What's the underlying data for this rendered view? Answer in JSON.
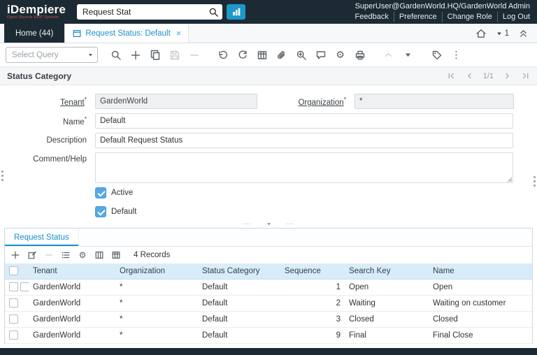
{
  "header": {
    "logo": "iDempiere",
    "tagline": "Open Source ERP System",
    "search": {
      "value": "Request Stat"
    },
    "user": "SuperUser@GardenWorld.HQ/GardenWorld Admin",
    "links": {
      "feedback": "Feedback",
      "preference": "Preference",
      "change_role": "Change Role",
      "logout": "Log Out"
    }
  },
  "tabbar": {
    "home_tab": "Home (44)",
    "active_tab": "Request Status: Default",
    "close": "×",
    "window_count": "1"
  },
  "toolbar": {
    "select_query": "Select Query"
  },
  "titlebar": {
    "title": "Status Category",
    "page_indicator": "1/1"
  },
  "form": {
    "tenant": {
      "label": "Tenant",
      "required": "*",
      "value": "GardenWorld"
    },
    "organization": {
      "label": "Organization",
      "required": "*",
      "value": "*"
    },
    "name": {
      "label": "Name",
      "required": "*",
      "value": "Default"
    },
    "description": {
      "label": "Description",
      "value": "Default Request Status"
    },
    "comment": {
      "label": "Comment/Help",
      "value": ""
    },
    "active": {
      "label": "Active",
      "checked": true
    },
    "default": {
      "label": "Default",
      "checked": true
    }
  },
  "detail": {
    "tab": "Request Status",
    "records": "4 Records",
    "columns": {
      "tenant": "Tenant",
      "organization": "Organization",
      "status_category": "Status Category",
      "sequence": "Sequence",
      "search_key": "Search Key",
      "name": "Name"
    },
    "rows": [
      {
        "tenant": "GardenWorld",
        "organization": "*",
        "status_category": "Default",
        "sequence": "1",
        "search_key": "Open",
        "name": "Open"
      },
      {
        "tenant": "GardenWorld",
        "organization": "*",
        "status_category": "Default",
        "sequence": "2",
        "search_key": "Waiting",
        "name": "Waiting on customer"
      },
      {
        "tenant": "GardenWorld",
        "organization": "*",
        "status_category": "Default",
        "sequence": "3",
        "search_key": "Closed",
        "name": "Closed"
      },
      {
        "tenant": "GardenWorld",
        "organization": "*",
        "status_category": "Default",
        "sequence": "9",
        "search_key": "Final",
        "name": "Final Close"
      }
    ]
  },
  "icons": {
    "gear": "⚙",
    "dots_vertical": "⋮"
  },
  "colors": {
    "accent": "#1d8fc9",
    "header_bg": "#1c2b33",
    "table_header_bg": "#d9ecf9",
    "checkbox": "#57a8e5"
  }
}
